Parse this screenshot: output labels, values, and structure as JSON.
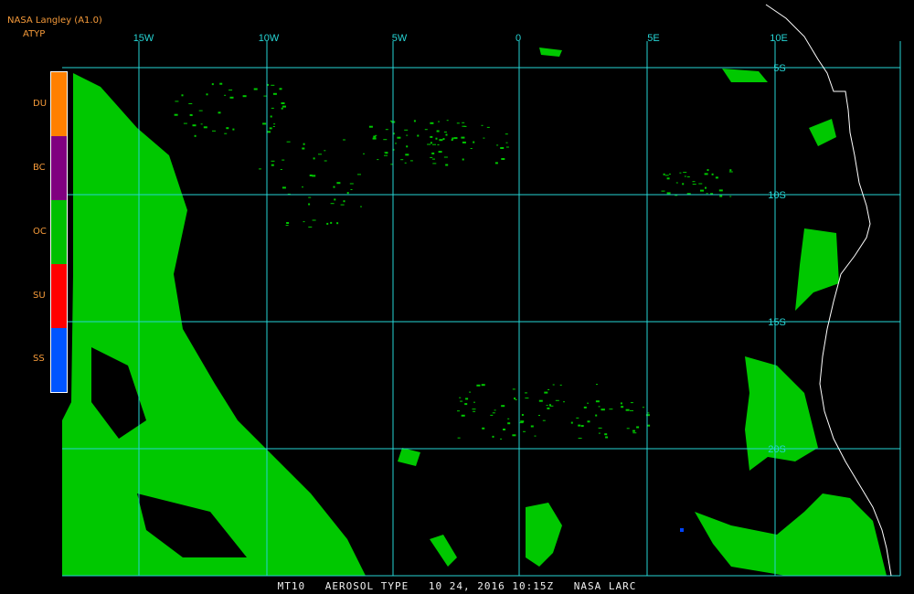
{
  "header": {
    "source": "NASA Langley (A1.0)",
    "product": "ATYP"
  },
  "map": {
    "longitude_labels": [
      "15W",
      "10W",
      "5W",
      "0",
      "5E",
      "10E"
    ],
    "latitude_labels": [
      "5S",
      "10S",
      "15S",
      "20S"
    ],
    "gridline_color": "#26d5d5",
    "coastline_color": "#ffffff",
    "background": "#000000",
    "dominant_class_color": "#00c800"
  },
  "legend": {
    "items": [
      {
        "code": "DU",
        "color": "#ff8000"
      },
      {
        "code": "BC",
        "color": "#800080"
      },
      {
        "code": "OC",
        "color": "#00c000"
      },
      {
        "code": "SU",
        "color": "#ff0000"
      },
      {
        "code": "SS",
        "color": "#0055ff"
      }
    ]
  },
  "footer": {
    "sat": "MT10",
    "product": "AEROSOL TYPE",
    "date": "10 24, 2016 10:15Z",
    "org": "NASA LARC"
  }
}
